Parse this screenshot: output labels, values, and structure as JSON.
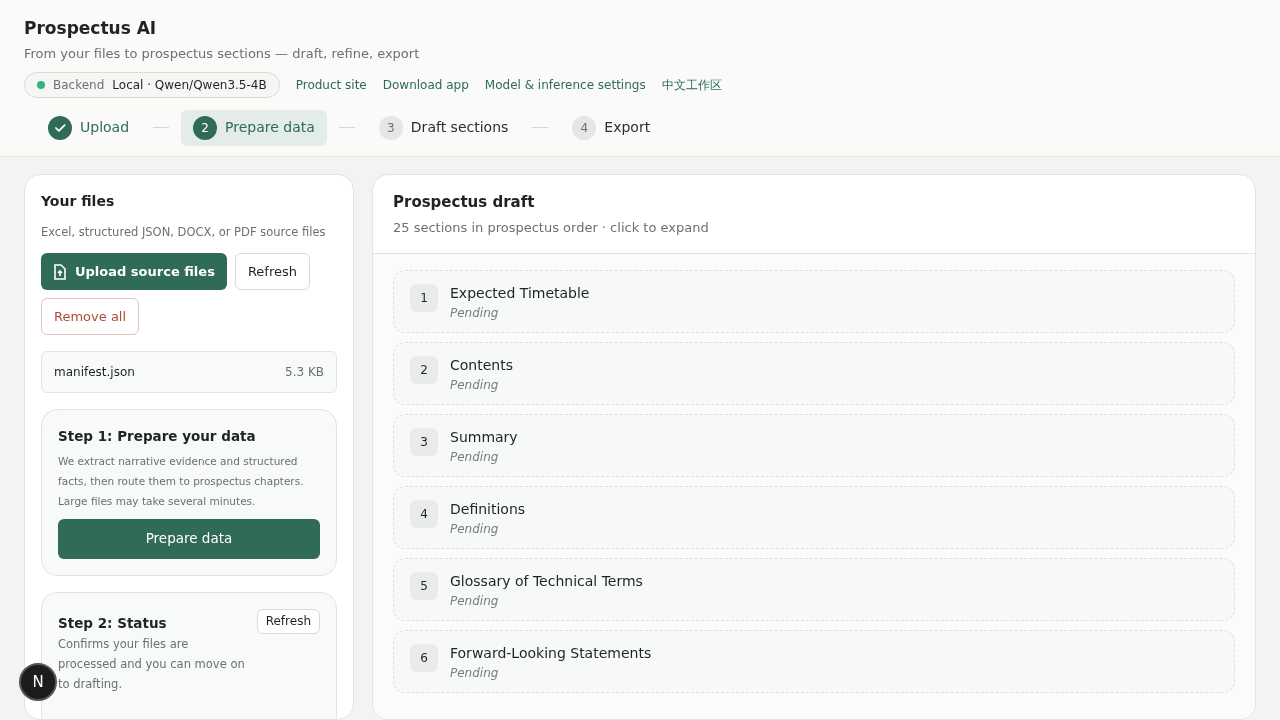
{
  "app": {
    "title": "Prospectus AI",
    "subtitle": "From your files to prospectus sections — draft, refine, export"
  },
  "backend": {
    "label": "Backend",
    "value": "Local · Qwen/Qwen3.5-4B",
    "online": true
  },
  "links": [
    "Product site",
    "Download app",
    "Model & inference settings",
    "中文工作区"
  ],
  "steps": [
    {
      "label": "Upload",
      "done": true,
      "selected": false
    },
    {
      "number": "2",
      "label": "Prepare data",
      "done": false,
      "selected": true
    },
    {
      "number": "3",
      "label": "Draft sections",
      "done": false,
      "selected": false
    },
    {
      "number": "4",
      "label": "Export",
      "done": false,
      "selected": false
    }
  ],
  "files_panel": {
    "title": "Your files",
    "hint": "Excel, structured JSON, DOCX, or PDF source files",
    "upload_button": "Upload source files",
    "refresh_button": "Refresh",
    "remove_button": "Remove all",
    "files": [
      {
        "name": "manifest.json",
        "size": "5.3 KB"
      }
    ],
    "step1": {
      "title": "Step 1: Prepare your data",
      "text": "We extract narrative evidence and structured facts, then route them to prospectus chapters. Large files may take several minutes.",
      "button": "Prepare data"
    },
    "step2": {
      "title": "Step 2: Status",
      "button": "Refresh",
      "text": "Confirms your files are processed and you can move on to drafting."
    }
  },
  "draft": {
    "title": "Prospectus draft",
    "subtitle": "25 sections in prospectus order · click to expand",
    "sections": [
      {
        "number": "1",
        "title": "Expected Timetable",
        "status": "Pending"
      },
      {
        "number": "2",
        "title": "Contents",
        "status": "Pending"
      },
      {
        "number": "3",
        "title": "Summary",
        "status": "Pending"
      },
      {
        "number": "4",
        "title": "Definitions",
        "status": "Pending"
      },
      {
        "number": "5",
        "title": "Glossary of Technical Terms",
        "status": "Pending"
      },
      {
        "number": "6",
        "title": "Forward-Looking Statements",
        "status": "Pending"
      }
    ]
  },
  "dev_badge": "N"
}
